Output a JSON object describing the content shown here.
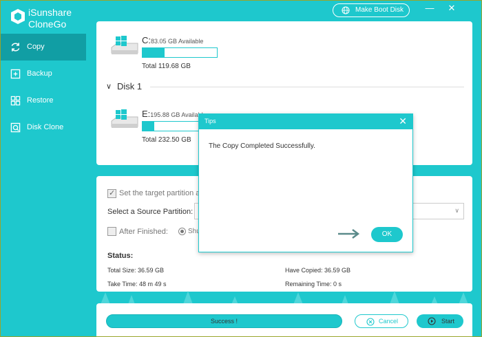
{
  "app": {
    "name_line1": "iSunshare",
    "name_line2": "CloneGo"
  },
  "sidebar": {
    "items": [
      {
        "label": "Copy",
        "icon": "refresh-icon",
        "active": true
      },
      {
        "label": "Backup",
        "icon": "backup-icon"
      },
      {
        "label": "Restore",
        "icon": "restore-icon"
      },
      {
        "label": "Disk Clone",
        "icon": "disk-clone-icon"
      }
    ]
  },
  "topbar": {
    "make_boot_disk": "Make Boot Disk",
    "minimize": "—",
    "close": "✕"
  },
  "disks": {
    "c": {
      "letter": "C:",
      "available": "83.05 GB Available",
      "total": "Total 119.68 GB",
      "used_fraction": 0.3
    },
    "group_label": "Disk 1",
    "e": {
      "letter": "E:",
      "available": "195.88 GB Available",
      "total": "Total 232.50 GB",
      "used_fraction": 0.16
    }
  },
  "settings": {
    "target_partition_label": "Set the target partition a",
    "source_label": "Select a Source Partition:",
    "after_finished_label": "After Finished:",
    "shutdown_label": "Shu"
  },
  "status": {
    "title": "Status:",
    "total_size": "Total Size: 36.59 GB",
    "have_copied": "Have Copied: 36.59 GB",
    "take_time": "Take Time: 48 m 49 s",
    "remaining_time": "Remaining Time: 0 s"
  },
  "bottom": {
    "progress_text": "Success !",
    "progress_fraction": 1.0,
    "cancel": "Cancel",
    "start": "Start"
  },
  "dialog": {
    "title": "Tips",
    "message": "The Copy Completed Successfully.",
    "ok": "OK"
  },
  "colors": {
    "accent": "#1ec8cd",
    "sidebar_active": "#119ea4",
    "arrow": "#5a8a8a"
  }
}
